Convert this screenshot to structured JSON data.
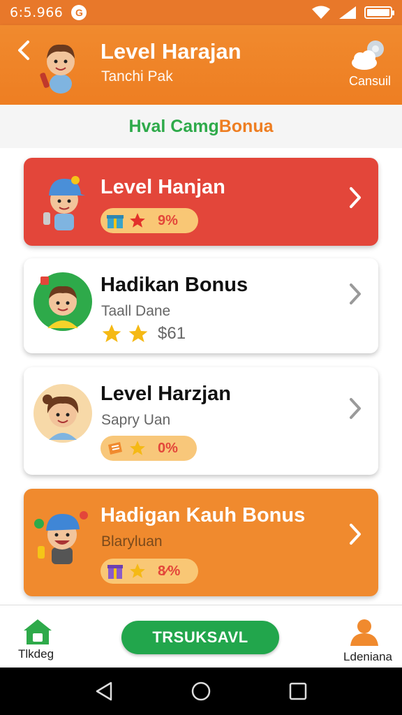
{
  "status_bar": {
    "time": "6:5.966",
    "sync_badge": "G"
  },
  "header": {
    "title": "Level Harajan",
    "subtitle": "Tanchi Pak",
    "action_label": "Cansuil"
  },
  "banner": {
    "part1": "Hval Camg",
    "part2": "Bonua"
  },
  "cards": [
    {
      "title": "Level Hanjan",
      "badge_value": "9%",
      "style": "red"
    },
    {
      "title": "Hadikan Bonus",
      "subtitle": "Taall Dane",
      "price": "$61",
      "style": "white"
    },
    {
      "title": "Level Harzjan",
      "subtitle": "Sapry Uan",
      "badge_value": "0%",
      "style": "white"
    },
    {
      "title": "Hadigan Kauh Bonus",
      "subtitle": "Blaryluan",
      "badge_value": "8⁄%",
      "style": "orange"
    }
  ],
  "tab_bar": {
    "home_label": "Tlkdeg",
    "primary_button": "TRSUKSAVL",
    "profile_label": "Ldeniana"
  },
  "colors": {
    "primary_orange": "#ee7e22",
    "alert_red": "#e3463a",
    "accent_green": "#22a64c"
  },
  "icons": {
    "back": "chevron-left-icon",
    "action": "cloud-gear-icon",
    "row_chevron": "chevron-right-icon",
    "home": "home-icon",
    "profile": "person-icon"
  }
}
